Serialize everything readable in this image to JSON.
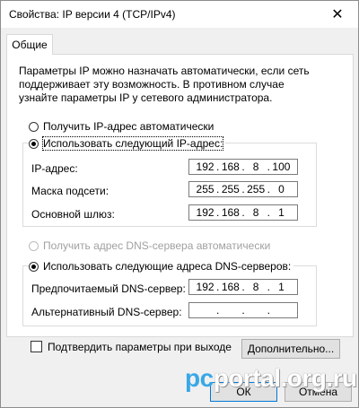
{
  "window": {
    "title": "Свойства: IP версии 4 (TCP/IPv4)",
    "close_glyph": "✕"
  },
  "tab": {
    "label": "Общие"
  },
  "description": "Параметры IP можно назначать автоматически, если сеть поддерживает эту возможность. В противном случае узнайте параметры IP у сетевого администратора.",
  "ip_mode": {
    "auto_label": "Получить IP-адрес автоматически",
    "manual_label": "Использовать следующий IP-адрес:",
    "selected": "manual"
  },
  "ip_fields": {
    "ip": {
      "label": "IP-адрес:",
      "octets": [
        "192",
        "168",
        "8",
        "100"
      ]
    },
    "mask": {
      "label": "Маска подсети:",
      "octets": [
        "255",
        "255",
        "255",
        "0"
      ]
    },
    "gateway": {
      "label": "Основной шлюз:",
      "octets": [
        "192",
        "168",
        "8",
        "1"
      ]
    }
  },
  "dns_mode": {
    "auto_label": "Получить адрес DNS-сервера автоматически",
    "manual_label": "Использовать следующие адреса DNS-серверов:",
    "selected": "manual"
  },
  "dns_fields": {
    "preferred": {
      "label": "Предпочитаемый DNS-сервер:",
      "octets": [
        "192",
        "168",
        "8",
        "1"
      ]
    },
    "alternate": {
      "label": "Альтернативный DNS-сервер:",
      "octets": [
        "",
        "",
        "",
        ""
      ]
    }
  },
  "validate": {
    "label": "Подтвердить параметры при выходе",
    "checked": false
  },
  "buttons": {
    "advanced": "Дополнительно...",
    "ok": "ОК",
    "cancel": "Отмена"
  },
  "watermark": {
    "prefix": "pc",
    "rest": "portal.org.ru"
  }
}
